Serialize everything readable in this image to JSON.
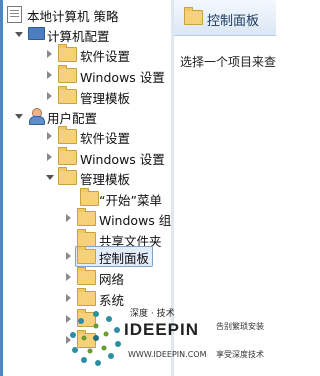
{
  "tree": {
    "root": "本地计算机 策略",
    "computer_config": "计算机配置",
    "cc_software": "软件设置",
    "cc_windows": "Windows 设置",
    "cc_admin": "管理模板",
    "user_config": "用户配置",
    "uc_software": "软件设置",
    "uc_windows": "Windows 设置",
    "uc_admin": "管理模板",
    "start_menu": "“开始”菜单",
    "windows_components": "Windows 组",
    "shared_folders": "共享文件夹",
    "control_panel": "控制面板",
    "network": "网络",
    "system": "系统"
  },
  "right_pane": {
    "title": "控制面板",
    "hint": "选择一个项目来查"
  },
  "watermark": {
    "brand": "深度 · 技术",
    "logo": "IDEEPIN",
    "url": "WWW.IDEEPIN.COM",
    "slogan1": "告别繁琐安装",
    "slogan2": "享受深度技术"
  },
  "colors": {
    "accent": "#4a86c8",
    "selection": "#e3edf9",
    "folder": "#f5d27a"
  }
}
